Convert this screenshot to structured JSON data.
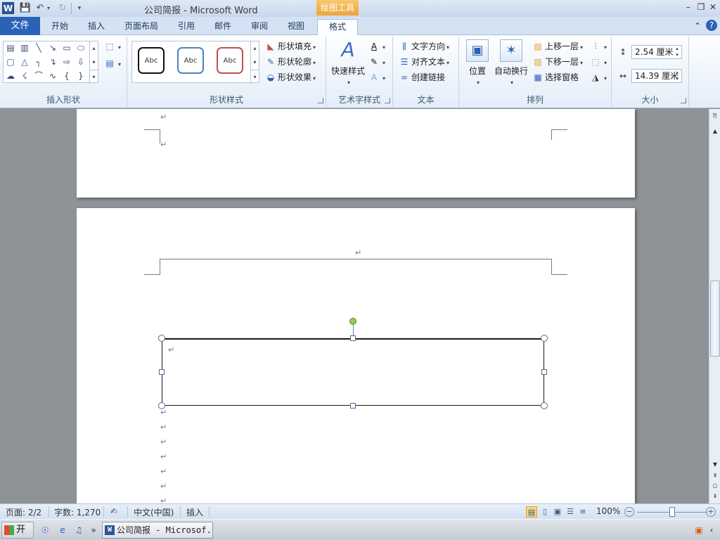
{
  "titlebar": {
    "app_icon": "W",
    "doc_title": "公司简报  -  Microsoft Word",
    "context_tool": "绘图工具",
    "icons": [
      "save-icon",
      "undo-icon",
      "redo-icon",
      "customize-qat-icon",
      "minimize-icon",
      "restore-icon",
      "close-icon"
    ]
  },
  "tabs": [
    {
      "label": "文件"
    },
    {
      "label": "开始"
    },
    {
      "label": "插入"
    },
    {
      "label": "页面布局"
    },
    {
      "label": "引用"
    },
    {
      "label": "邮件"
    },
    {
      "label": "审阅"
    },
    {
      "label": "视图"
    },
    {
      "label": "格式"
    }
  ],
  "ribbon": {
    "groups": {
      "insert_shapes": "插入形状",
      "shape_styles": "形状样式",
      "wordart": "艺术字样式",
      "text": "文本",
      "arrange": "排列",
      "size": "大小"
    },
    "style_samples": [
      "Abc",
      "Abc",
      "Abc"
    ],
    "shape_fill": "形状填充",
    "shape_outline": "形状轮廓",
    "shape_effects": "形状效果",
    "quick_styles": "快速样式",
    "text_direction": "文字方向",
    "align_text": "对齐文本",
    "create_link": "创建链接",
    "position": "位置",
    "wrap_text": "自动换行",
    "bring_forward": "上移一层",
    "send_backward": "下移一层",
    "selection_pane": "选择窗格",
    "height_value": "2.54 厘米",
    "width_value": "14.39 厘米"
  },
  "statusbar": {
    "page": "页面: 2/2",
    "words": "字数: 1,270",
    "language": "中文(中国)",
    "mode": "插入",
    "zoom": "100%",
    "zoom_level": 1.0
  },
  "taskbar": {
    "start": "开始",
    "word_task": "公司简报 - Microsof..."
  }
}
